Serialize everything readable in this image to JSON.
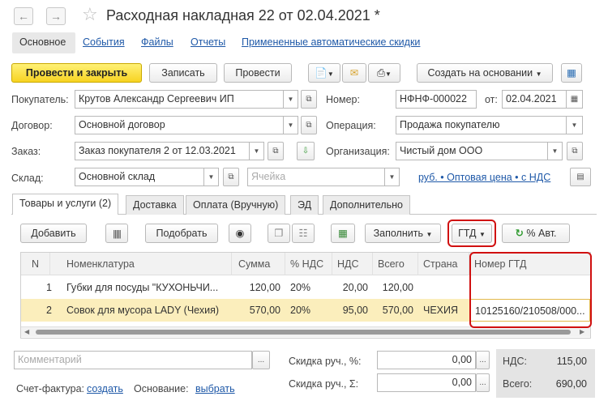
{
  "window": {
    "title": "Расходная накладная 22 от 02.04.2021 *",
    "back_icon": "arrow-left-icon",
    "forward_icon": "arrow-right-icon",
    "favorite_icon": "star-icon"
  },
  "nav_tabs": [
    "Основное",
    "События",
    "Файлы",
    "Отчеты",
    "Примененные автоматические скидки"
  ],
  "toolbar": {
    "post_close": "Провести и закрыть",
    "save": "Записать",
    "post": "Провести",
    "create_based": "Создать на основании"
  },
  "form": {
    "buyer_label": "Покупатель:",
    "buyer": "Крутов Александр Сергеевич ИП",
    "number_label": "Номер:",
    "number": "НФНФ-000022",
    "date_label": "от:",
    "date": "02.04.2021",
    "contract_label": "Договор:",
    "contract": "Основной договор",
    "operation_label": "Операция:",
    "operation": "Продажа покупателю",
    "order_label": "Заказ:",
    "order": "Заказ покупателя 2 от 12.03.2021",
    "org_label": "Организация:",
    "org": "Чистый дом ООО",
    "warehouse_label": "Склад:",
    "warehouse": "Основной склад",
    "cell_placeholder": "Ячейка",
    "price_link": "руб. • Оптовая цена • с НДС"
  },
  "doc_tabs": [
    "Товары и услуги (2)",
    "Доставка",
    "Оплата (Вручную)",
    "ЭД",
    "Дополнительно"
  ],
  "grid_toolbar": {
    "add": "Добавить",
    "pick": "Подобрать",
    "fill": "Заполнить",
    "gtd": "ГТД",
    "vat_auto": "% Авт."
  },
  "table": {
    "headers": [
      "N",
      "Номенклатура",
      "Сумма",
      "% НДС",
      "НДС",
      "Всего",
      "Страна",
      "Номер ГТД"
    ],
    "rows": [
      [
        "1",
        "Губки для посуды \"КУХОНЬЧИ...",
        "120,00",
        "20%",
        "20,00",
        "120,00",
        "",
        ""
      ],
      [
        "2",
        "Совок для мусора LADY (Чехия)",
        "570,00",
        "20%",
        "95,00",
        "570,00",
        "ЧЕХИЯ",
        "10125160/210508/000..."
      ]
    ]
  },
  "footer": {
    "comment_placeholder": "Комментарий",
    "discount_pct_label": "Скидка руч., %:",
    "discount_pct": "0,00",
    "discount_sum_label": "Скидка руч., Σ:",
    "discount_sum": "0,00",
    "vat_label": "НДС:",
    "vat": "115,00",
    "total_label": "Всего:",
    "total": "690,00",
    "invoice_label": "Счет-фактура:",
    "invoice_link": "создать",
    "basis_label": "Основание:",
    "basis_link": "выбрать"
  },
  "colors": {
    "accent_yellow": "#f7d322",
    "selected_row": "#fbeebc",
    "highlight_red": "#d01010",
    "link_blue": "#1f59a8"
  }
}
